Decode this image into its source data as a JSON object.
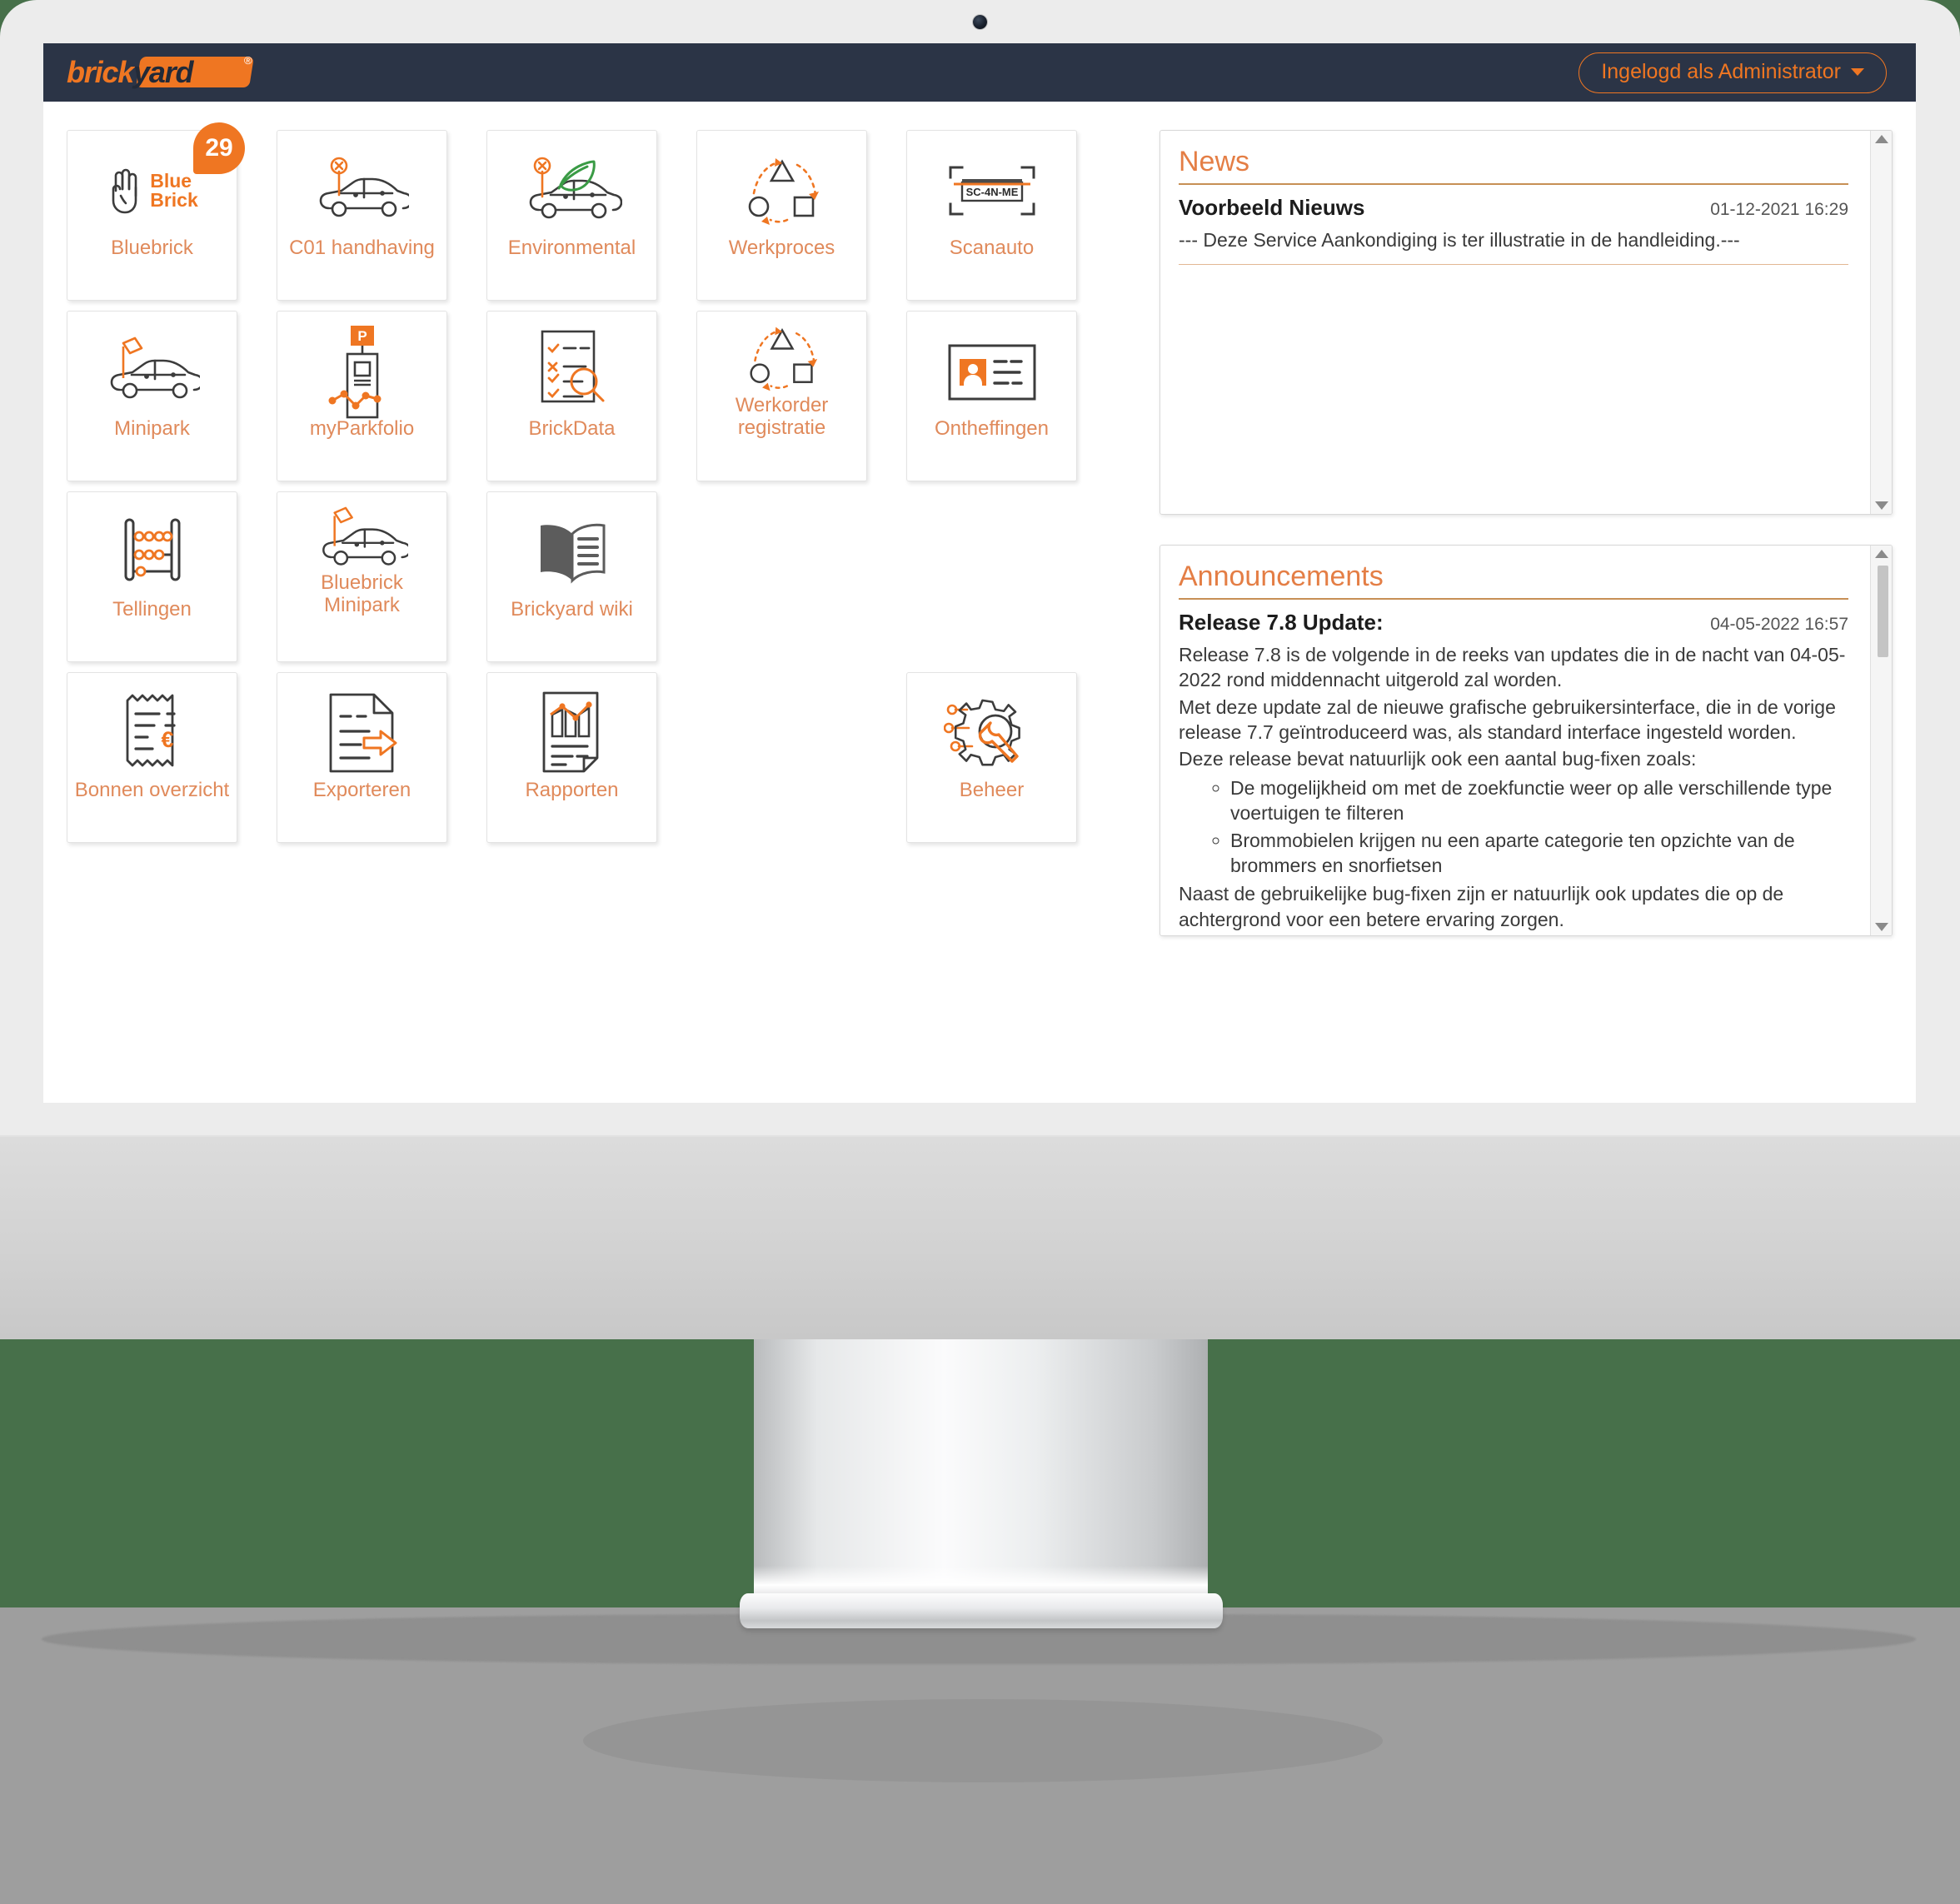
{
  "header": {
    "logo_part1": "brick",
    "logo_part2": "yard",
    "logo_reg": "®",
    "login_label": "Ingelogd als Administrator"
  },
  "tiles": [
    [
      {
        "label": "Bluebrick",
        "icon": "bluebrick-logo-icon",
        "badge": "29",
        "bb_line1": "Blue",
        "bb_line2": "Brick"
      },
      {
        "label": "C01 handhaving",
        "icon": "car-pin-icon"
      },
      {
        "label": "Environmental",
        "icon": "car-leaf-icon"
      },
      {
        "label": "Werkproces",
        "icon": "process-flow-icon"
      },
      {
        "label": "Scanauto",
        "icon": "license-plate-scan-icon",
        "plate": "SC-4N-ME"
      }
    ],
    [
      {
        "label": "Minipark",
        "icon": "car-flag-icon"
      },
      {
        "label": "myParkfolio",
        "icon": "parking-meter-chart-icon",
        "meter_p": "P"
      },
      {
        "label": "BrickData",
        "icon": "checklist-magnifier-icon"
      },
      {
        "label": "Werkorder registratie",
        "icon": "process-flow-icon"
      },
      {
        "label": "Ontheffingen",
        "icon": "id-card-icon"
      }
    ],
    [
      {
        "label": "Tellingen",
        "icon": "abacus-icon"
      },
      {
        "label": "Bluebrick Minipark",
        "icon": "car-flag-icon"
      },
      {
        "label": "Brickyard wiki",
        "icon": "open-book-icon"
      },
      {
        "label": "",
        "icon": ""
      },
      {
        "label": "",
        "icon": ""
      }
    ],
    [
      {
        "label": "Bonnen overzicht",
        "icon": "receipt-euro-icon"
      },
      {
        "label": "Exporteren",
        "icon": "document-export-icon"
      },
      {
        "label": "Rapporten",
        "icon": "report-chart-icon"
      },
      {
        "label": "",
        "icon": ""
      },
      {
        "label": "Beheer",
        "icon": "gear-wrench-icon"
      }
    ]
  ],
  "news": {
    "title": "News",
    "item_title": "Voorbeeld Nieuws",
    "item_date": "01-12-2021 16:29",
    "item_body": "--- Deze Service Aankondiging is ter illustratie in de handleiding.---"
  },
  "announcements": {
    "title": "Announcements",
    "item_title": "Release 7.8 Update:",
    "item_date": "04-05-2022 16:57",
    "para1": "Release 7.8 is de volgende in de reeks van updates die in de nacht van 04-05-2022 rond middennacht uitgerold zal worden.",
    "para2": "Met deze update zal de nieuwe grafische gebruikersinterface, die in de vorige release 7.7 geïntroduceerd was, als standard interface ingesteld worden.",
    "para3": "Deze release bevat natuurlijk ook een aantal bug-fixen zoals:",
    "bullet1": "De mogelijkheid om met de zoekfunctie weer op alle verschillende type voertuigen te filteren",
    "bullet2": "Brommobielen krijgen nu een aparte categorie ten opzichte van de brommers en snorfietsen",
    "para4": "Naast de gebruikelijke bug-fixen zijn er natuurlijk ook updates die op de achtergrond voor een betere ervaring zorgen."
  },
  "colors": {
    "brand_orange": "#ef7622",
    "header_navy": "#2b3446",
    "label_orange": "#e08a5b",
    "leaf_green": "#3a9b45",
    "background_green": "#47704a"
  }
}
